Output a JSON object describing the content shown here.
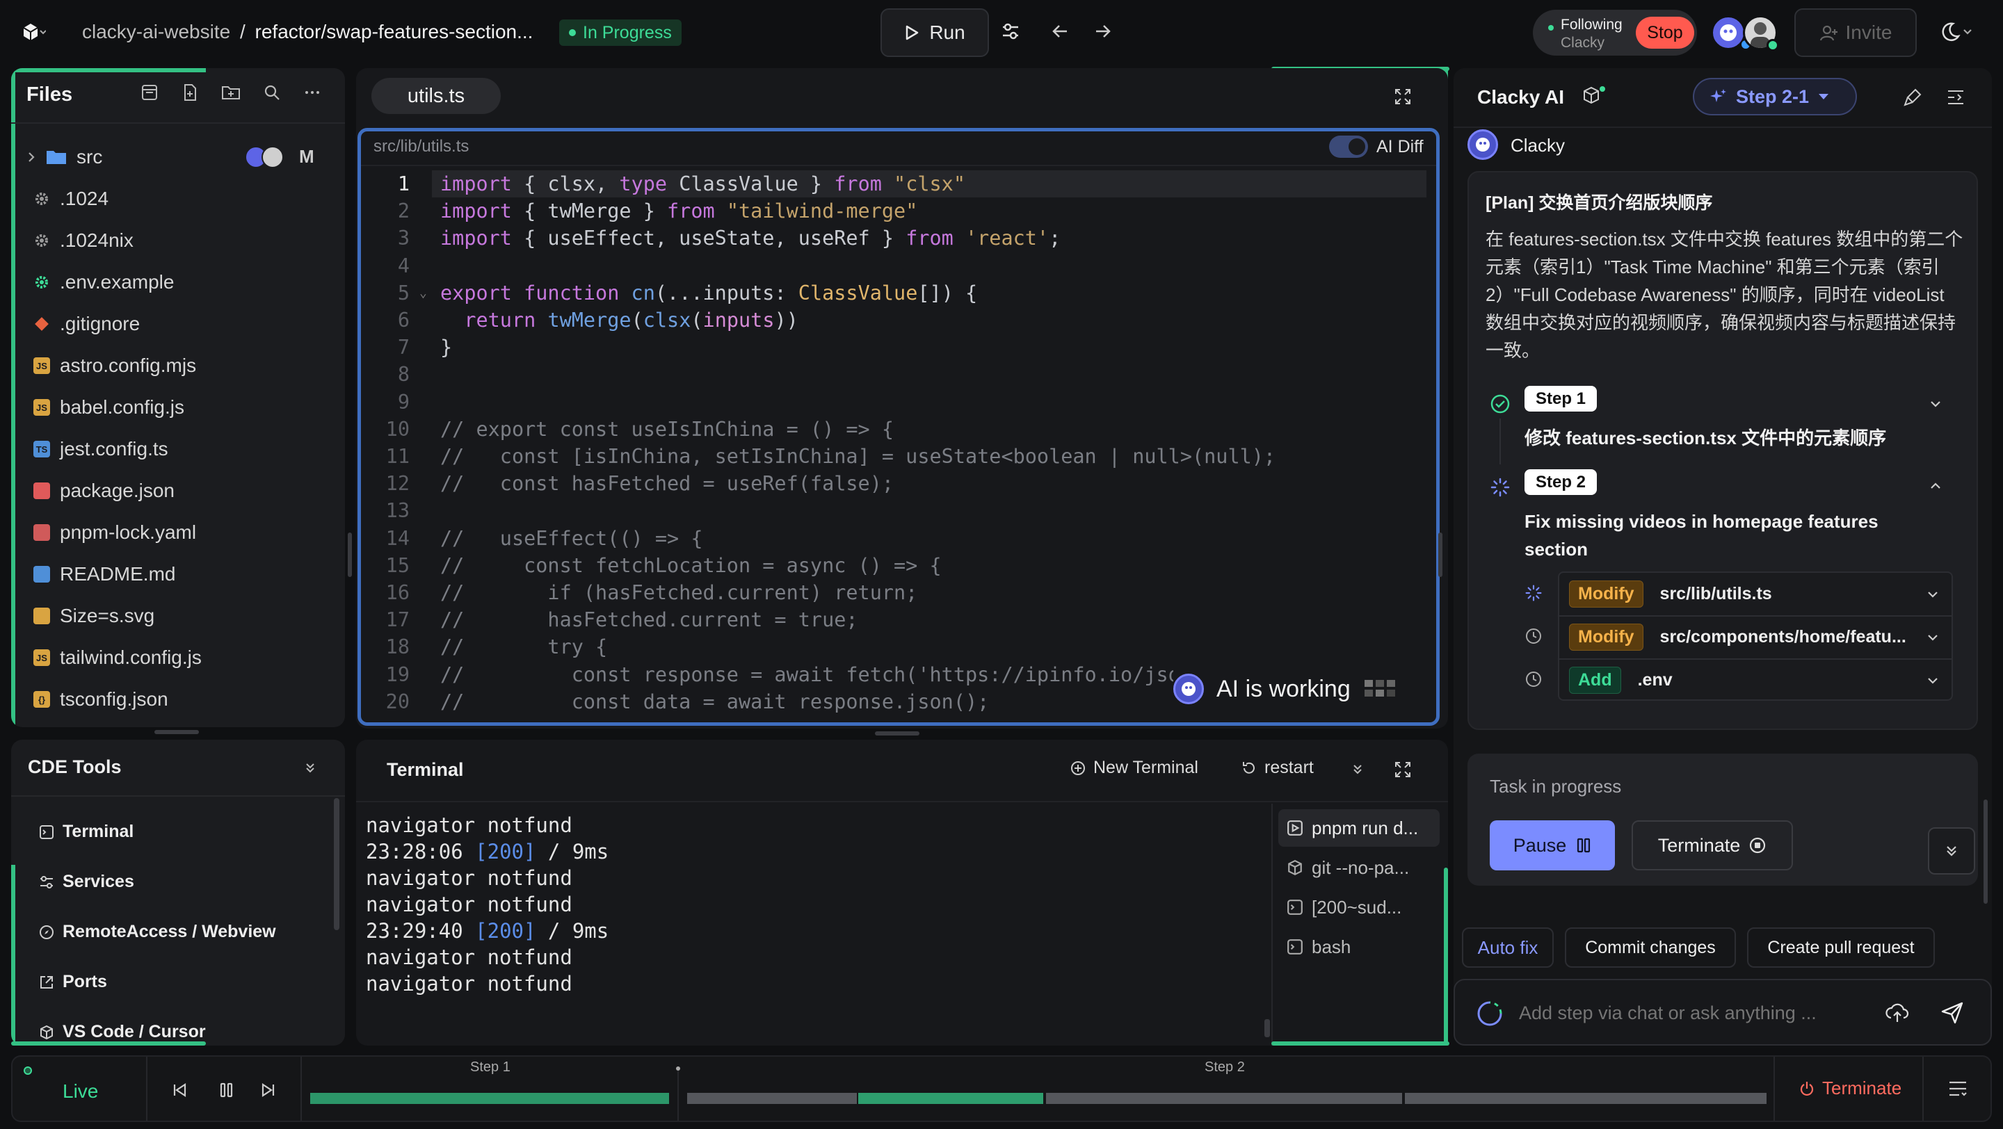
{
  "topbar": {
    "project": "clacky-ai-website",
    "separator": "/",
    "branch": "refactor/swap-features-section...",
    "status": "In Progress",
    "run_label": "Run",
    "following_label": "Following",
    "following_name": "Clacky",
    "stop_label": "Stop",
    "invite_label": "Invite"
  },
  "files": {
    "title": "Files",
    "items": [
      {
        "name": "src",
        "type": "folder",
        "badge": "M"
      },
      {
        "name": ".1024",
        "type": "gear"
      },
      {
        "name": ".1024nix",
        "type": "gear"
      },
      {
        "name": ".env.example",
        "type": "gear-green"
      },
      {
        "name": ".gitignore",
        "type": "git"
      },
      {
        "name": "astro.config.mjs",
        "type": "js"
      },
      {
        "name": "babel.config.js",
        "type": "js"
      },
      {
        "name": "jest.config.ts",
        "type": "ts"
      },
      {
        "name": "package.json",
        "type": "pkg"
      },
      {
        "name": "pnpm-lock.yaml",
        "type": "yaml"
      },
      {
        "name": "README.md",
        "type": "md"
      },
      {
        "name": "Size=s.svg",
        "type": "svg"
      },
      {
        "name": "tailwind.config.js",
        "type": "js"
      },
      {
        "name": "tsconfig.json",
        "type": "json"
      }
    ]
  },
  "cde": {
    "title": "CDE Tools",
    "items": [
      "Terminal",
      "Services",
      "RemoteAccess / Webview",
      "Ports",
      "VS Code / Cursor"
    ]
  },
  "editor": {
    "tab": "utils.ts",
    "path": "src/lib/utils.ts",
    "ai_diff_label": "AI Diff",
    "ai_working_label": "AI is working",
    "line_numbers": [
      "1",
      "2",
      "3",
      "4",
      "5",
      "6",
      "7",
      "8",
      "9",
      "10",
      "11",
      "12",
      "13",
      "14",
      "15",
      "16",
      "17",
      "18",
      "19",
      "20"
    ]
  },
  "terminal": {
    "title": "Terminal",
    "new_label": "New Terminal",
    "restart_label": "restart",
    "lines": [
      {
        "text": "navigator notfund"
      },
      {
        "time": "23:28:06",
        "code": "[200]",
        "rest": " / 9ms"
      },
      {
        "text": "navigator notfund"
      },
      {
        "text": "navigator notfund"
      },
      {
        "time": "23:29:40",
        "code": "[200]",
        "rest": " / 9ms"
      },
      {
        "text": "navigator notfund"
      },
      {
        "text": "navigator notfund"
      }
    ],
    "sessions": [
      "pnpm run d...",
      "git --no-pa...",
      "[200~sud...",
      "bash"
    ]
  },
  "ai": {
    "title": "Clacky AI",
    "step_selector": "Step 2-1",
    "agent_name": "Clacky",
    "plan_title": "[Plan] 交换首页介绍版块顺序",
    "plan_desc": "在 features-section.tsx 文件中交换 features 数组中的第二个元素（索引1）\"Task Time Machine\" 和第三个元素（索引2）\"Full Codebase Awareness\" 的顺序，同时在 videoList 数组中交换对应的视频顺序，确保视频内容与标题描述保持一致。",
    "step1_tag": "Step 1",
    "step1_title": "修改 features-section.tsx 文件中的元素顺序",
    "step2_tag": "Step 2",
    "step2_title": "Fix missing videos in homepage features section",
    "subtasks": [
      {
        "action": "Modify",
        "file": "src/lib/utils.ts"
      },
      {
        "action": "Modify",
        "file": "src/components/home/featu..."
      },
      {
        "action": "Add",
        "file": ".env"
      }
    ],
    "task_status": "Task in progress",
    "pause_label": "Pause",
    "terminate_label": "Terminate",
    "autofix_label": "Auto fix",
    "commit_label": "Commit changes",
    "pr_label": "Create pull request",
    "chat_placeholder": "Add step via chat or ask anything ..."
  },
  "timeline": {
    "live_label": "Live",
    "step1_label": "Step 1",
    "step2_label": "Step 2",
    "terminate_label": "Terminate"
  },
  "colors": {
    "accent_green": "#34c184",
    "editor_border": "#3f6ec0",
    "stop_red": "#ff5a4f",
    "pause_blue": "#7b8cff"
  }
}
